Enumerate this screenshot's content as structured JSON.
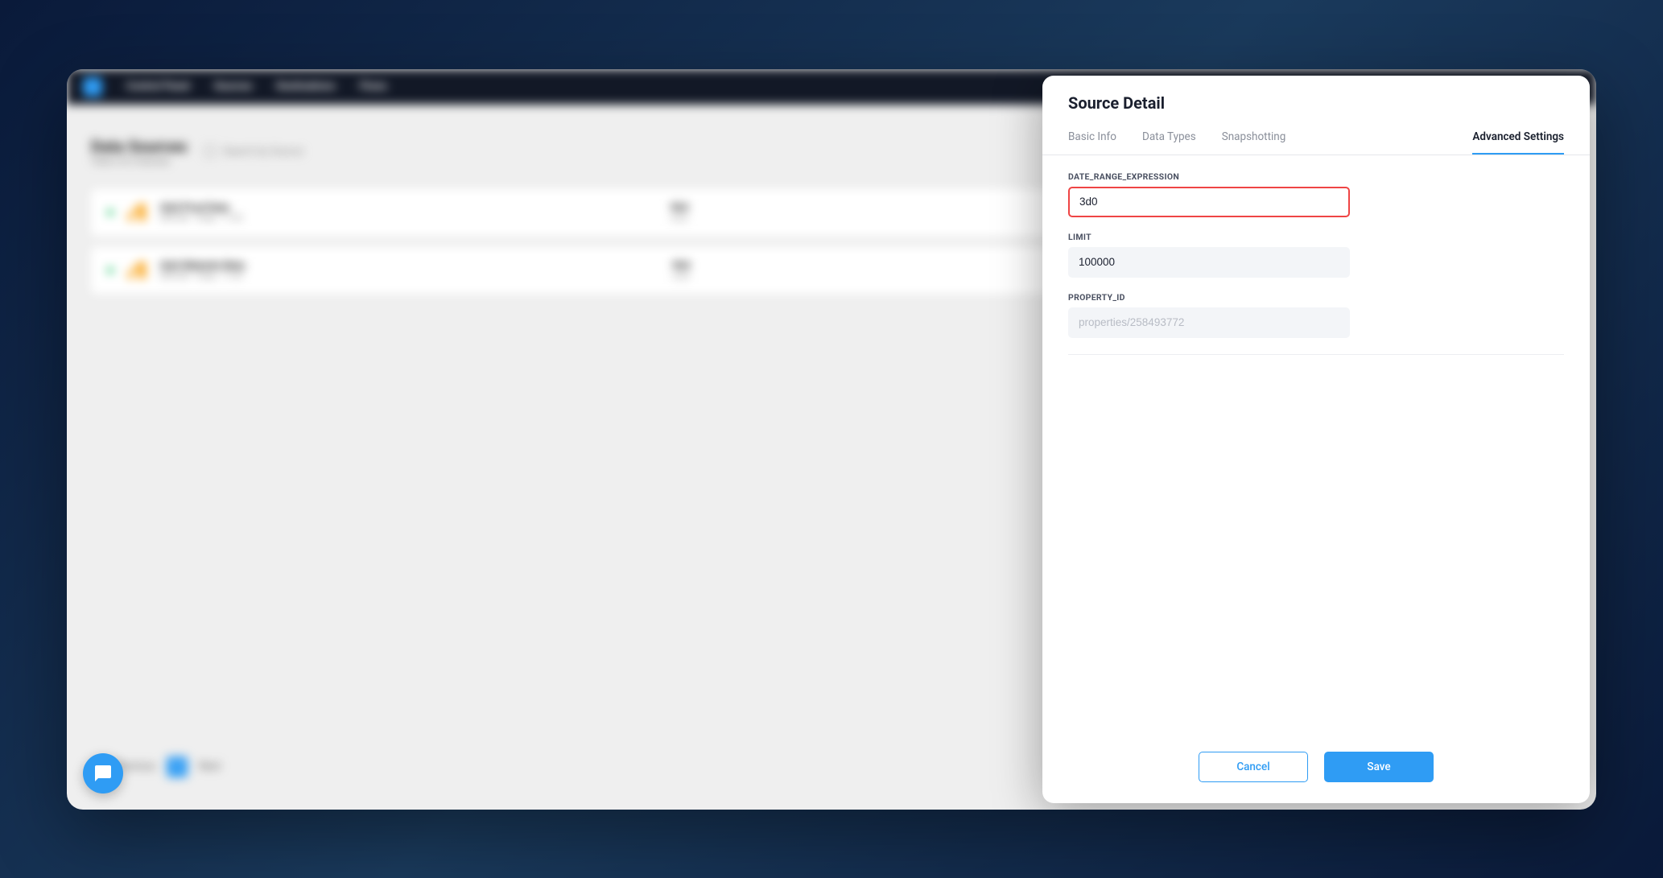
{
  "nav": {
    "items": [
      "Control Panel",
      "Sources",
      "Destinations",
      "Flows"
    ]
  },
  "page": {
    "title": "Data Sources",
    "subtitle": "Total 2 of 2 Sources",
    "searchPlaceholder": "Search by Source"
  },
  "rows": [
    {
      "name": "GA4 Prod Data",
      "meta": "ERP/DB · Today · 11:30",
      "midTitle": "964",
      "midSub": "rows",
      "status": "active"
    },
    {
      "name": "GA4 Website Beta",
      "meta": "ERP/DB · Today · 11:30",
      "midTitle": "964",
      "midSub": "rows",
      "status": "active"
    }
  ],
  "pager": {
    "prev": "Previous",
    "page": "1",
    "next": "Next"
  },
  "panel": {
    "title": "Source Detail",
    "tabs": [
      "Basic Info",
      "Data Types",
      "Snapshotting",
      "Advanced Settings"
    ],
    "activeTab": 3,
    "fields": {
      "dateRange": {
        "label": "DATE_RANGE_EXPRESSION",
        "value": "3d0"
      },
      "limit": {
        "label": "LIMIT",
        "value": "100000"
      },
      "propertyId": {
        "label": "PROPERTY_ID",
        "value": "properties/258493772"
      }
    },
    "buttons": {
      "cancel": "Cancel",
      "save": "Save"
    }
  },
  "colors": {
    "accent": "#2f9cf4",
    "danger": "#ef4444",
    "success": "#29c76f"
  }
}
